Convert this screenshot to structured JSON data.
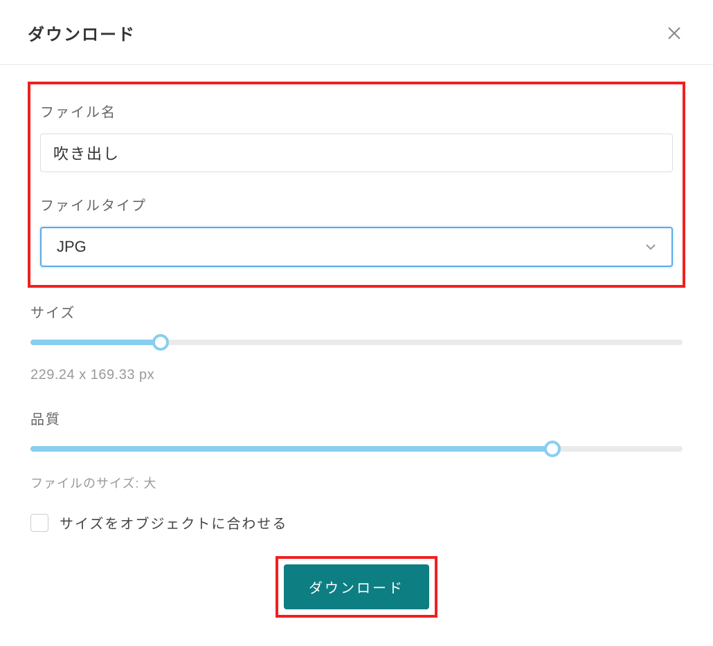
{
  "header": {
    "title": "ダウンロード"
  },
  "filename": {
    "label": "ファイル名",
    "value": "吹き出し"
  },
  "filetype": {
    "label": "ファイルタイプ",
    "selected": "JPG"
  },
  "size": {
    "label": "サイズ",
    "dimensions": "229.24 x 169.33 px",
    "slider_percent": 20
  },
  "quality": {
    "label": "品質",
    "file_size_text": "ファイルのサイズ: 大",
    "slider_percent": 80
  },
  "fit_checkbox": {
    "label": "サイズをオブジェクトに合わせる",
    "checked": false
  },
  "download_button": {
    "label": "ダウンロード"
  }
}
